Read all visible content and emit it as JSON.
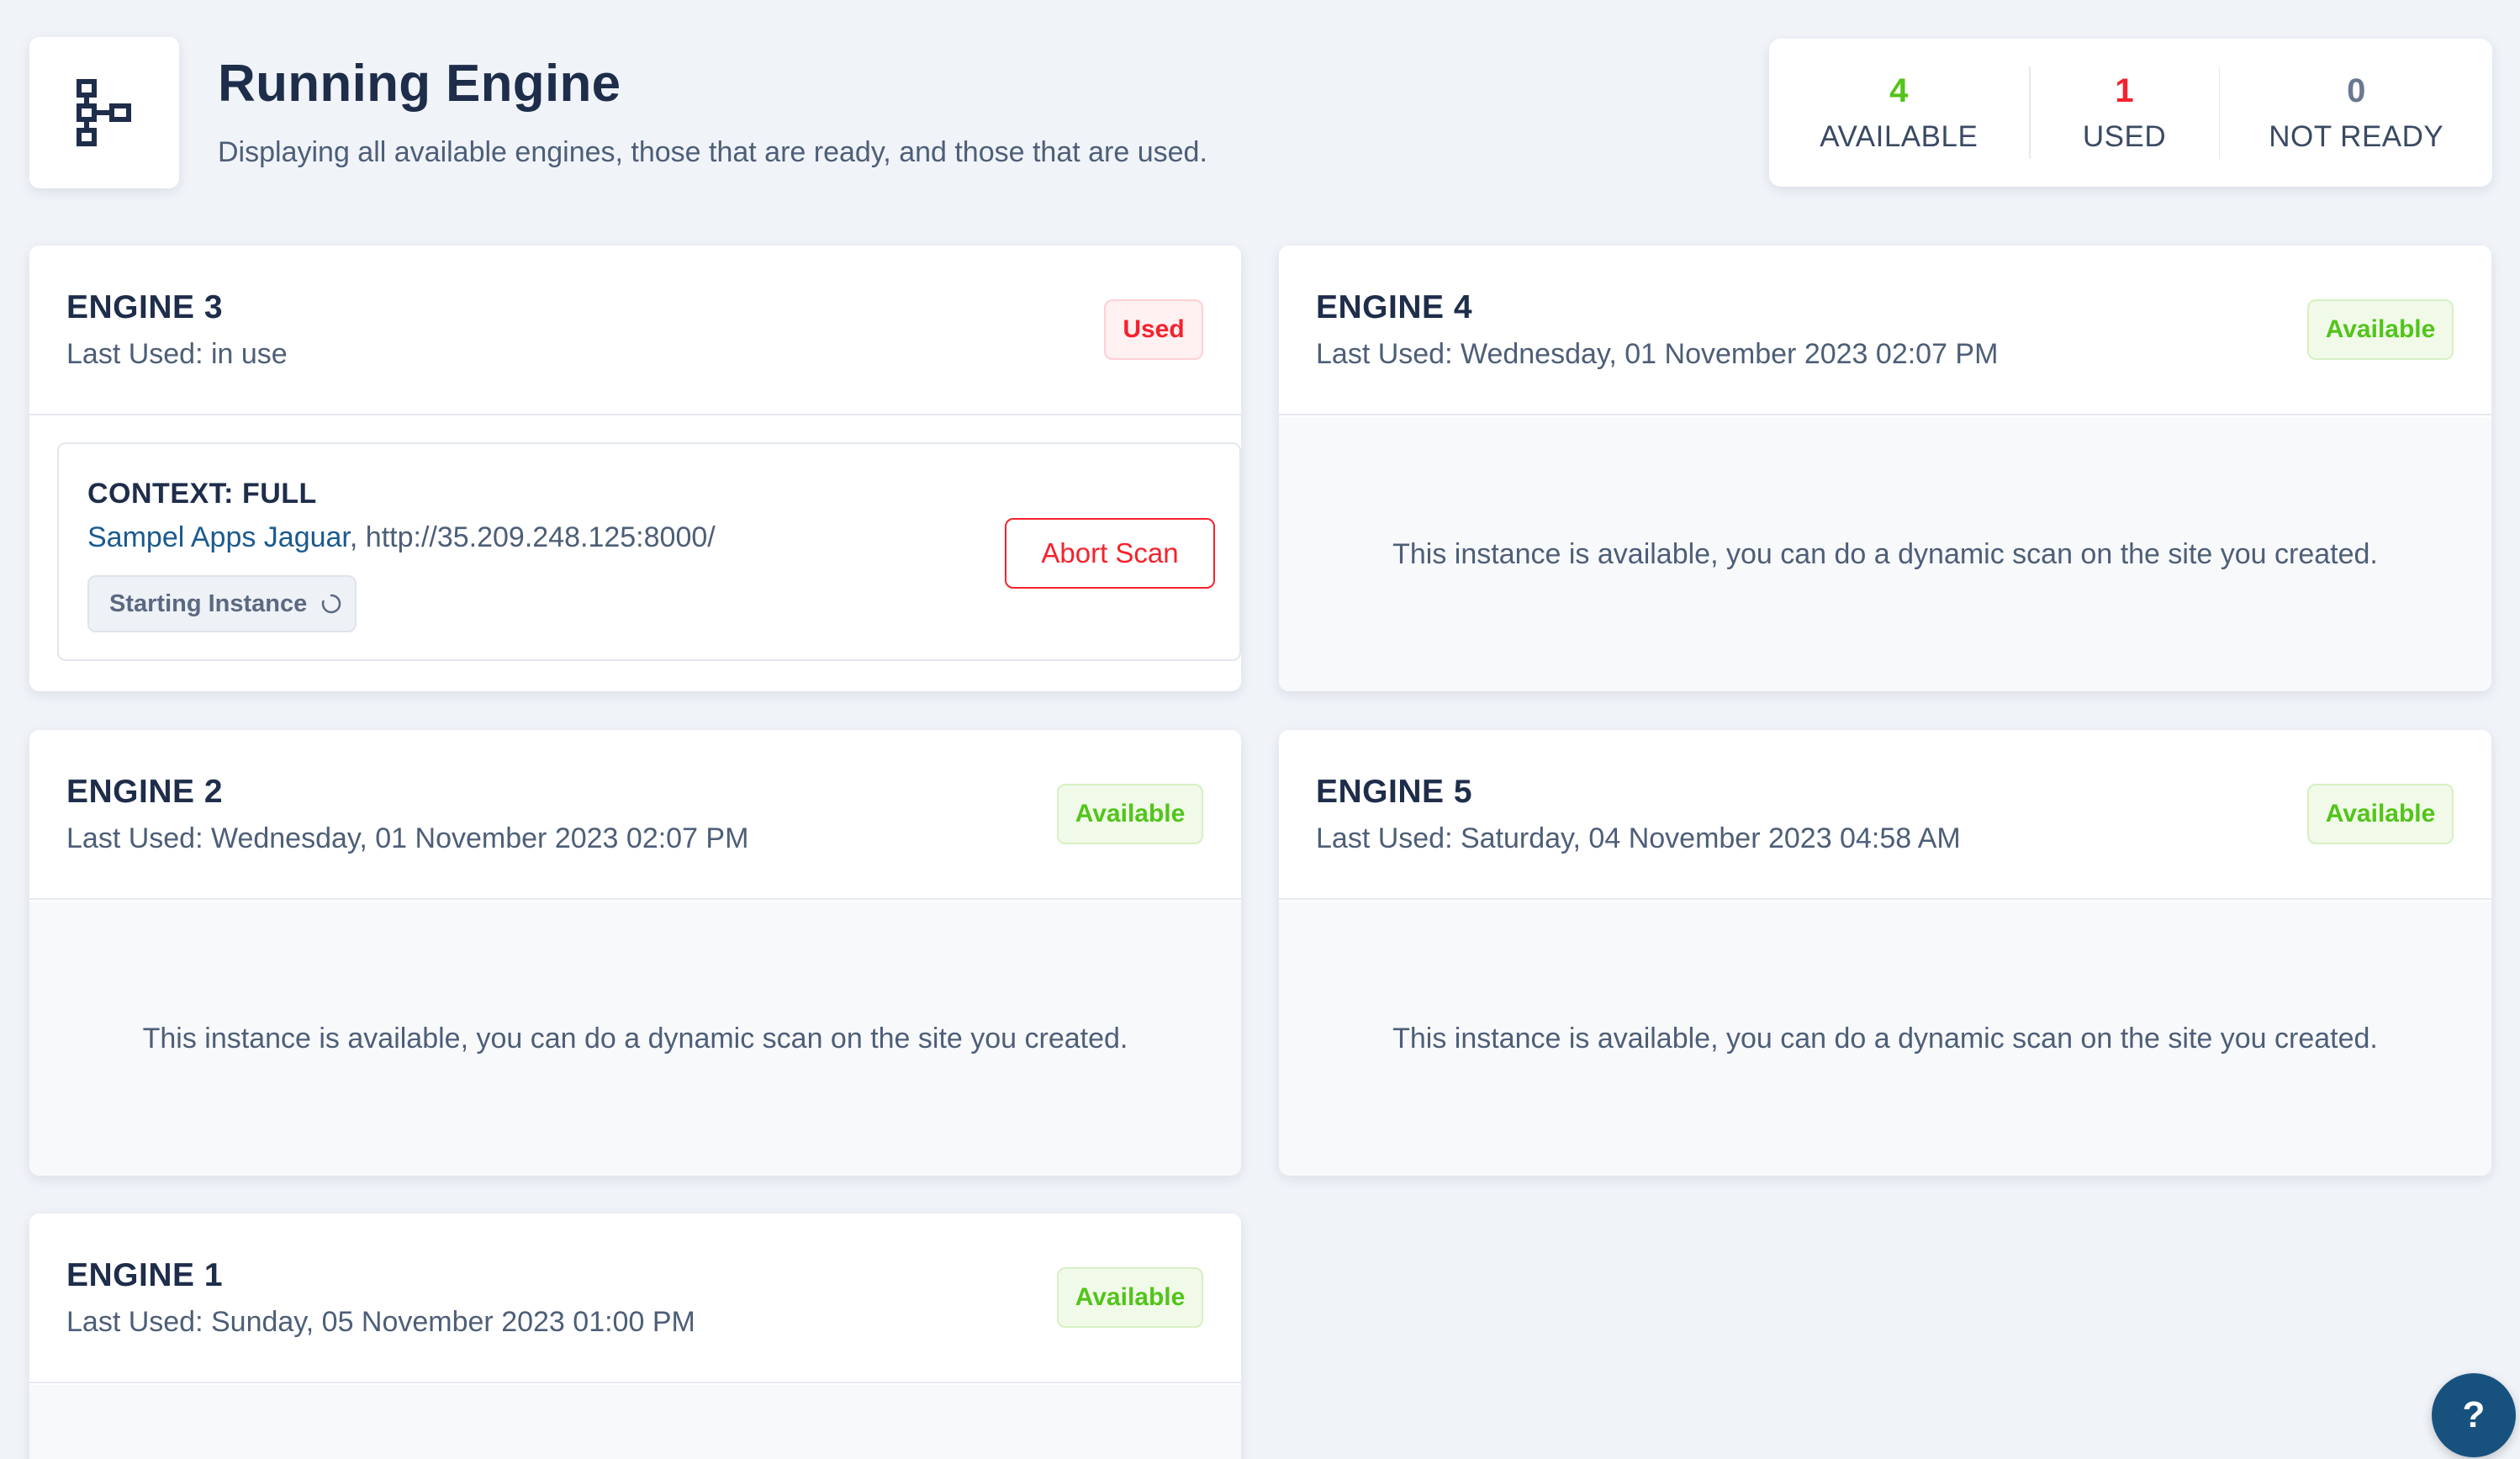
{
  "header": {
    "logo_icon": "sitemap-icon",
    "title": "Running Engine",
    "subtitle": "Displaying all available engines, those that are ready, and those that are used."
  },
  "stats": {
    "available": {
      "value": "4",
      "label": "AVAILABLE",
      "color": "#52c41a"
    },
    "used": {
      "value": "1",
      "label": "USED",
      "color": "#f5222d"
    },
    "not_ready": {
      "value": "0",
      "label": "NOT READY",
      "color": "#6b7891"
    }
  },
  "engines": {
    "engine3": {
      "title": "ENGINE 3",
      "last_used": "Last Used: in use",
      "status": "Used",
      "context": {
        "title": "CONTEXT: FULL",
        "app_name": "Sampel Apps Jaguar",
        "url_text": ", http://35.209.248.125:8000/",
        "instance_status": "Starting Instance",
        "abort_label": "Abort Scan"
      }
    },
    "engine4": {
      "title": "ENGINE 4",
      "last_used": "Last Used: Wednesday, 01 November 2023 02:07 PM",
      "status": "Available",
      "message": "This instance is available, you can do a dynamic scan on the site you created."
    },
    "engine2": {
      "title": "ENGINE 2",
      "last_used": "Last Used: Wednesday, 01 November 2023 02:07 PM",
      "status": "Available",
      "message": "This instance is available, you can do a dynamic scan on the site you created."
    },
    "engine5": {
      "title": "ENGINE 5",
      "last_used": "Last Used: Saturday, 04 November 2023 04:58 AM",
      "status": "Available",
      "message": "This instance is available, you can do a dynamic scan on the site you created."
    },
    "engine1": {
      "title": "ENGINE 1",
      "last_used": "Last Used: Sunday, 05 November 2023 01:00 PM",
      "status": "Available"
    }
  },
  "help": {
    "label": "?"
  },
  "colors": {
    "background": "#f0f3f8",
    "available": "#52c41a",
    "used": "#f5222d",
    "primary": "#17527f",
    "link": "#1a5a8f"
  }
}
